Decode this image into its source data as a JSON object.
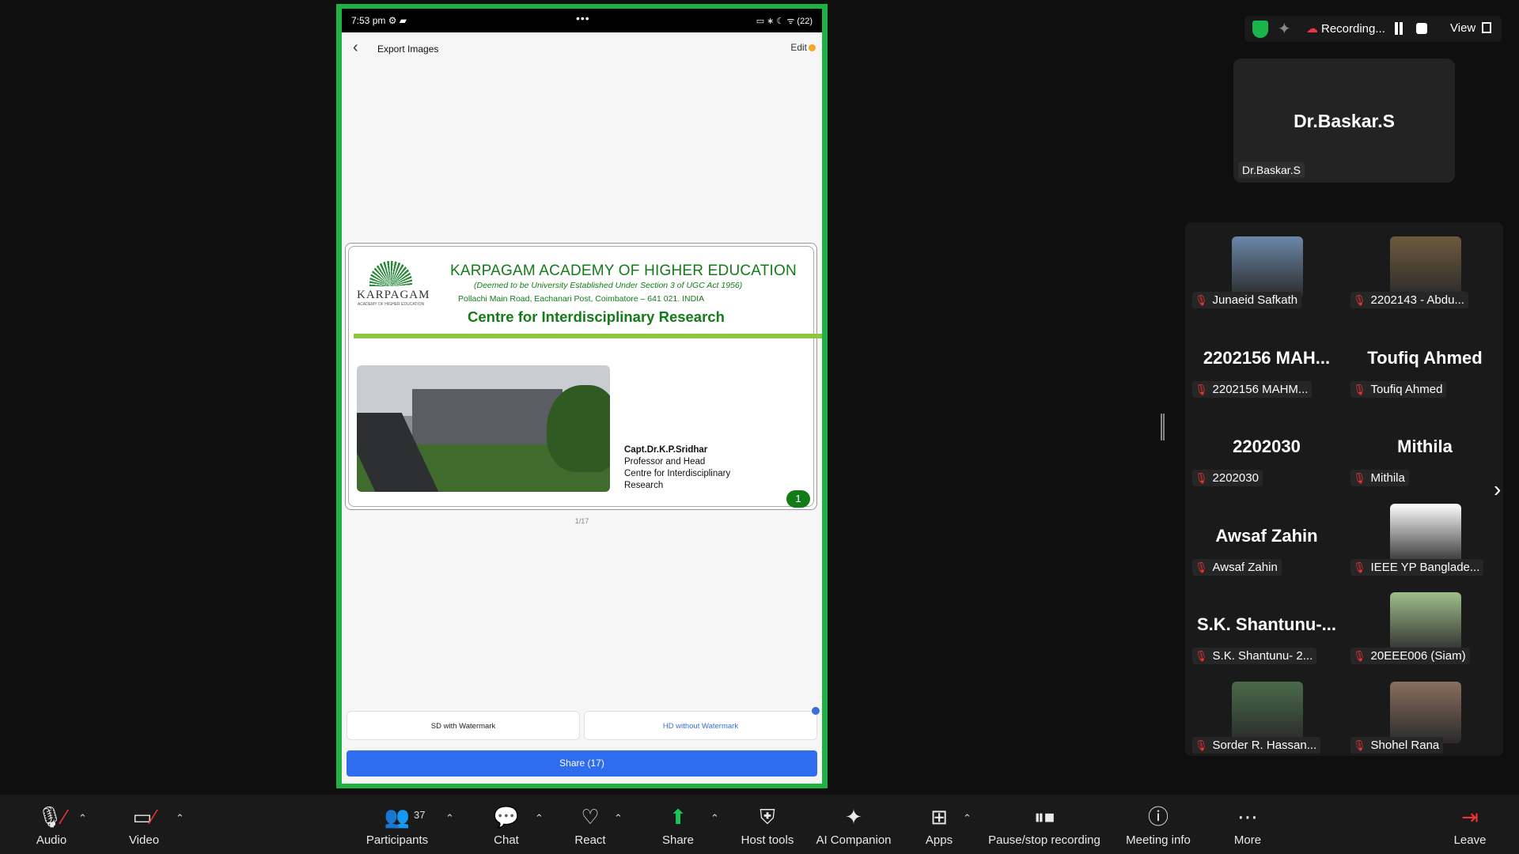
{
  "phone": {
    "status_time": "7:53 pm ⚙ ▰",
    "status_dots": "•••",
    "status_icons": "▭ ∗ ☾ ᯤ (22)",
    "title": "Export Images",
    "edit_label": "Edit",
    "slide": {
      "logo_name": "KARPAGAM",
      "logo_sub": "ACADEMY OF HIGHER EDUCATION",
      "university": "KARPAGAM ACADEMY OF HIGHER EDUCATION",
      "deemed": "(Deemed to be University Established Under Section 3 of UGC Act 1956)",
      "address": "Pollachi Main Road, Eachanari Post, Coimbatore – 641 021.  INDIA",
      "centre": "Centre for Interdisciplinary Research",
      "speaker_name": "Capt.Dr.K.P.Sridhar",
      "speaker_role": "Professor and Head",
      "speaker_dept": "Centre for Interdisciplinary Research",
      "slide_number": "1"
    },
    "pager": "1/17",
    "option_sd": "SD with Watermark",
    "option_hd": "HD without Watermark",
    "share_label": "Share  (17)"
  },
  "top_controls": {
    "recording_label": "Recording...",
    "view_label": "View"
  },
  "active_speaker": {
    "big_name": "Dr.Baskar.S",
    "label": "Dr.Baskar.S"
  },
  "gallery": [
    {
      "big": "",
      "label": "Junaeid Safkath",
      "has_video": true,
      "color": "#6b87a8"
    },
    {
      "big": "",
      "label": "2202143 -  Abdu...",
      "has_video": true,
      "color": "#6e5a3d"
    },
    {
      "big": "2202156  MAH...",
      "label": "2202156 MAHM...",
      "has_video": false
    },
    {
      "big": "Toufiq Ahmed",
      "label": "Toufiq Ahmed",
      "has_video": false
    },
    {
      "big": "2202030",
      "label": "2202030",
      "has_video": false
    },
    {
      "big": "Mithila",
      "label": "Mithila",
      "has_video": false
    },
    {
      "big": "Awsaf Zahin",
      "label": "Awsaf Zahin",
      "has_video": false
    },
    {
      "big": "",
      "label": "IEEE YP Banglade...",
      "has_video": true,
      "color": "#ffffff"
    },
    {
      "big": "S.K. Shantunu-...",
      "label": "S.K. Shantunu- 2...",
      "has_video": false
    },
    {
      "big": "",
      "label": "20EEE006 (Siam)",
      "has_video": true,
      "color": "#9fbf8a"
    },
    {
      "big": "",
      "label": "Sorder R. Hassan...",
      "has_video": true,
      "color": "#4a6a4a"
    },
    {
      "big": "",
      "label": "Shohel Rana",
      "has_video": true,
      "color": "#8a6e5e"
    }
  ],
  "toolbar": {
    "audio": "Audio",
    "video": "Video",
    "participants": "Participants",
    "participants_count": "37",
    "chat": "Chat",
    "react": "React",
    "share": "Share",
    "host_tools": "Host tools",
    "ai_companion": "AI Companion",
    "apps": "Apps",
    "pause_stop": "Pause/stop recording",
    "meeting_info": "Meeting info",
    "more": "More",
    "leave": "Leave"
  },
  "colors": {
    "share_border": "#1fb141",
    "slide_green": "#137b17",
    "share_button": "#2f6df0",
    "muted_red": "#e33333"
  }
}
